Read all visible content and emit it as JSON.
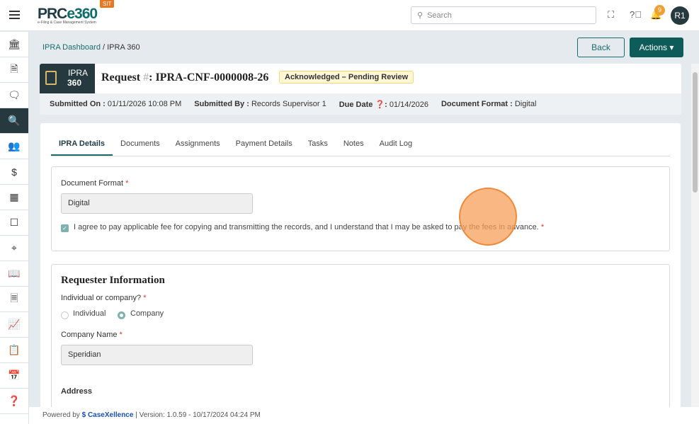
{
  "header": {
    "logo": "PRCe360",
    "logo_sub": "e-Filing & Case Management System",
    "env_badge": "SIT",
    "search_placeholder": "Search",
    "notification_count": "9",
    "avatar": "R1"
  },
  "sidebar": {
    "icons": [
      "bank-icon",
      "document-icon",
      "comment-icon",
      "document-search-icon",
      "users-icon",
      "invoice-icon",
      "building-icon",
      "task-icon",
      "scan-icon",
      "book-icon",
      "file-text-icon",
      "chart-icon",
      "clipboard-icon",
      "calendar-icon",
      "help-icon"
    ],
    "active_index": 3
  },
  "breadcrumb": {
    "parent": "IPRA Dashboard",
    "sep": " / ",
    "current": "IPRA 360"
  },
  "buttons": {
    "back": "Back",
    "actions": "Actions ▾"
  },
  "request": {
    "badge_line1": "IPRA",
    "badge_line2": "360",
    "title_prefix": "Request ",
    "hash": "#",
    "title_id": ": IPRA-CNF-0000008-26",
    "status": "Acknowledged – Pending Review",
    "meta": [
      {
        "label": "Submitted On :",
        "value": " 01/11/2026 10:08 PM"
      },
      {
        "label": "Submitted By :",
        "value": " Records Supervisor 1"
      },
      {
        "label": "Due Date ❓:",
        "value": " 01/14/2026"
      },
      {
        "label": "Document Format :",
        "value": " Digital"
      }
    ]
  },
  "tabs": [
    "IPRA Details",
    "Documents",
    "Assignments",
    "Payment Details",
    "Tasks",
    "Notes",
    "Audit Log"
  ],
  "doc_section": {
    "label": "Document Format",
    "value": "Digital",
    "agree": "I agree to pay applicable fee for copying and transmitting the records, and I understand that I may be asked to pay the fees in advance."
  },
  "requester": {
    "title": "Requester Information",
    "type_label": "Individual or company?",
    "opt1": "Individual",
    "opt2": "Company",
    "company_label": "Company Name",
    "company_value": "Speridian",
    "address_label": "Address"
  },
  "footer": {
    "powered": "Powered by ",
    "brand": "CaseXellence",
    "version": "  |  Version: 1.0.59 - 10/17/2024 04:24 PM"
  }
}
